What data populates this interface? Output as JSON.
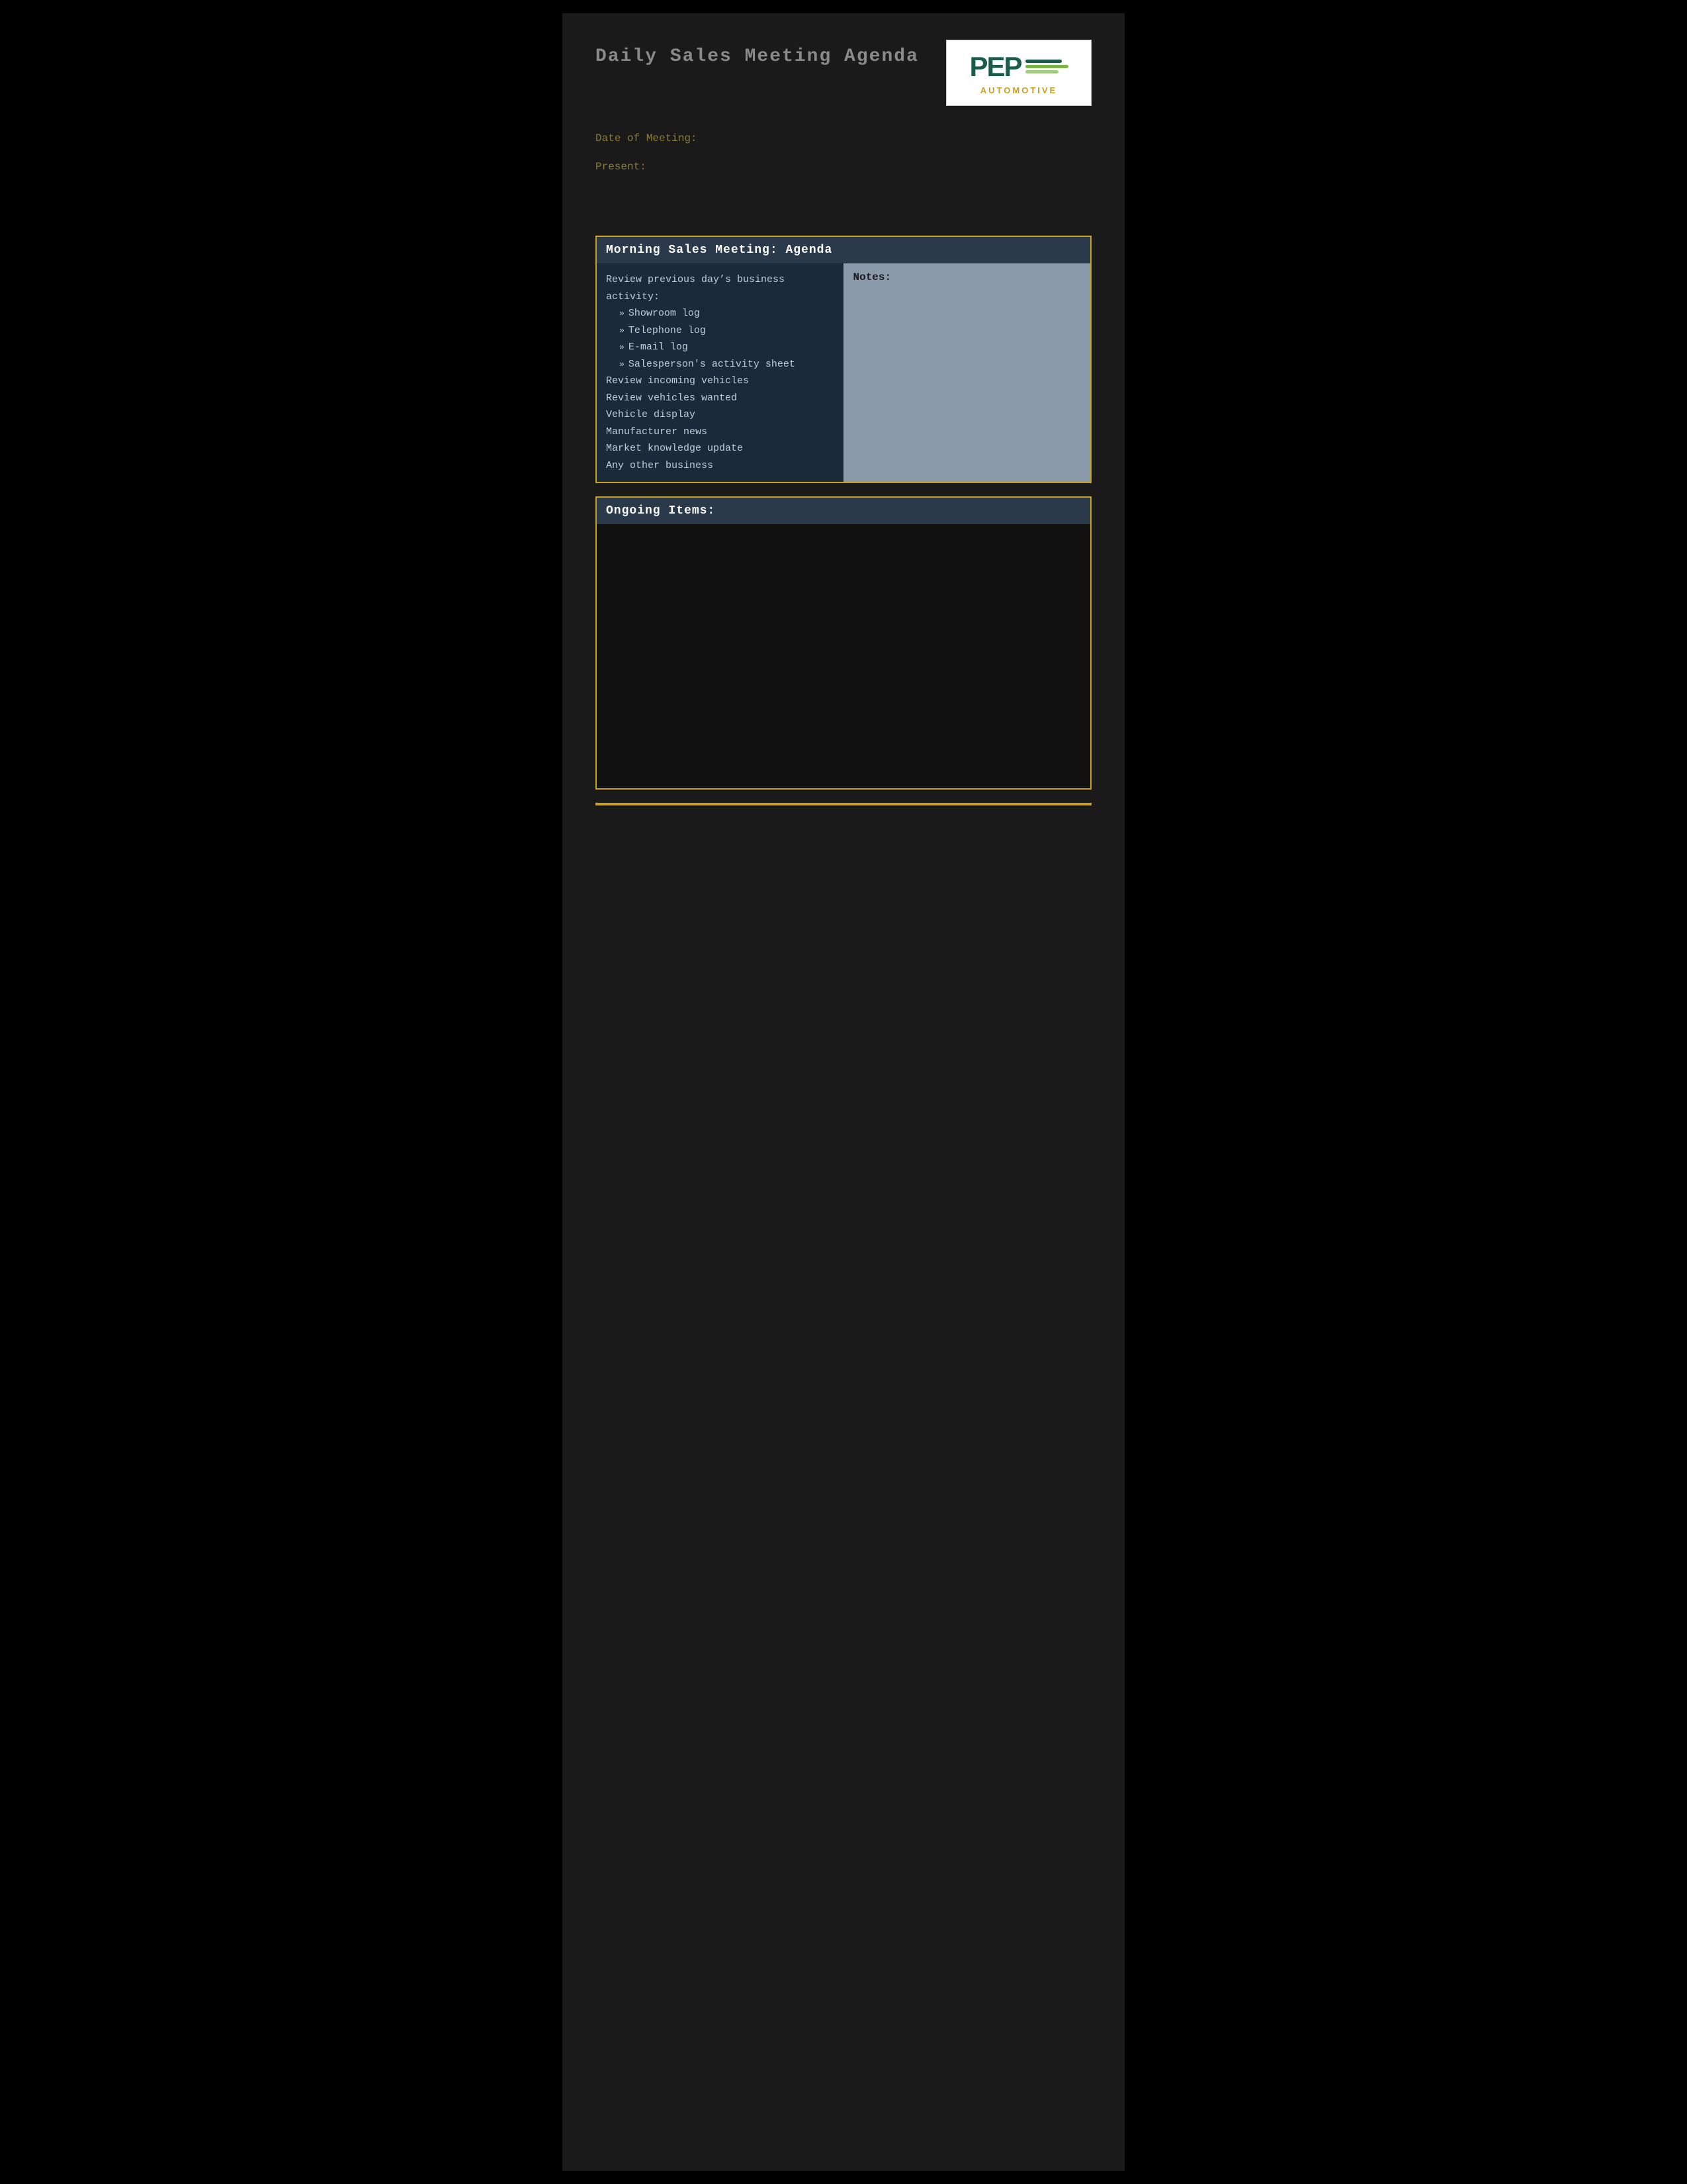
{
  "page": {
    "title": "Daily Sales Meeting Agenda",
    "background": "#1a1a1a"
  },
  "logo": {
    "pep_text": "PEP",
    "automotive_text": "AUTOMOTIVE"
  },
  "meta": {
    "date_label": "Date of Meeting:",
    "present_label": "Present:"
  },
  "morning_section": {
    "header": "Morning Sales Meeting: Agenda",
    "agenda_intro": "Review previous day’s business activity:",
    "agenda_sub_items": [
      "Showroom log",
      "Telephone log",
      "E-mail log",
      "Salesperson’s activity sheet"
    ],
    "agenda_items": [
      "Review incoming vehicles",
      "Review vehicles wanted",
      "Vehicle display",
      "Manufacturer news",
      "Market knowledge update",
      "Any other business"
    ],
    "notes_label": "Notes:"
  },
  "ongoing_section": {
    "header": "Ongoing Items:"
  }
}
